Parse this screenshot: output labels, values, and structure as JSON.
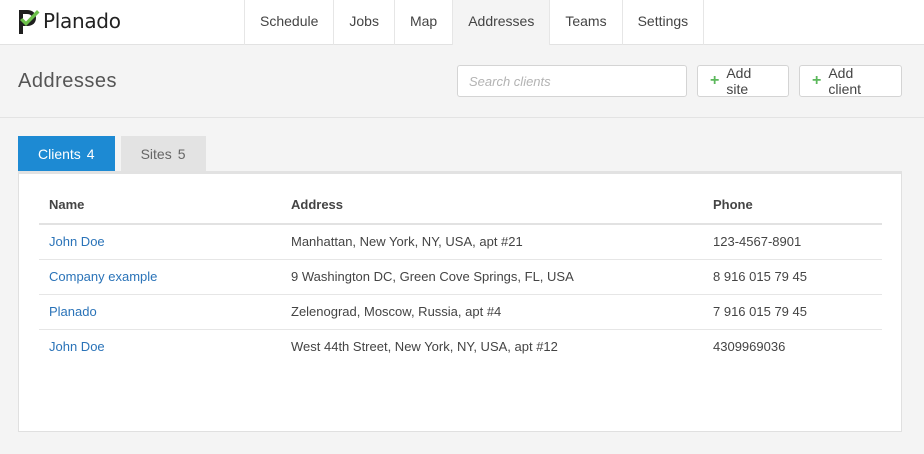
{
  "brand": {
    "name": "Planado",
    "accent": "#1d8ad3",
    "logo_green": "#6cc04a"
  },
  "nav": {
    "items": [
      {
        "label": "Schedule"
      },
      {
        "label": "Jobs"
      },
      {
        "label": "Map"
      },
      {
        "label": "Addresses",
        "active": true
      },
      {
        "label": "Teams"
      },
      {
        "label": "Settings"
      }
    ]
  },
  "header": {
    "title": "Addresses",
    "search": {
      "placeholder": "Search clients",
      "value": ""
    },
    "add_site_label": "Add site",
    "add_client_label": "Add client",
    "plus_icon": "plus-icon"
  },
  "tabs": [
    {
      "label": "Clients",
      "count": "4",
      "active": true
    },
    {
      "label": "Sites",
      "count": "5",
      "active": false
    }
  ],
  "table": {
    "columns": [
      "Name",
      "Address",
      "Phone"
    ],
    "rows": [
      {
        "name": "John Doe",
        "address": "Manhattan, New York, NY, USA, apt #21",
        "phone": "123-4567-8901"
      },
      {
        "name": "Company example",
        "address": "9 Washington DC, Green Cove Springs, FL, USA",
        "phone": "8 916 015 79 45"
      },
      {
        "name": "Planado",
        "address": "Zelenograd, Moscow, Russia, apt #4",
        "phone": "7 916 015 79 45"
      },
      {
        "name": "John Doe",
        "address": "West 44th Street, New York, NY, USA, apt #12",
        "phone": "4309969036"
      }
    ]
  }
}
